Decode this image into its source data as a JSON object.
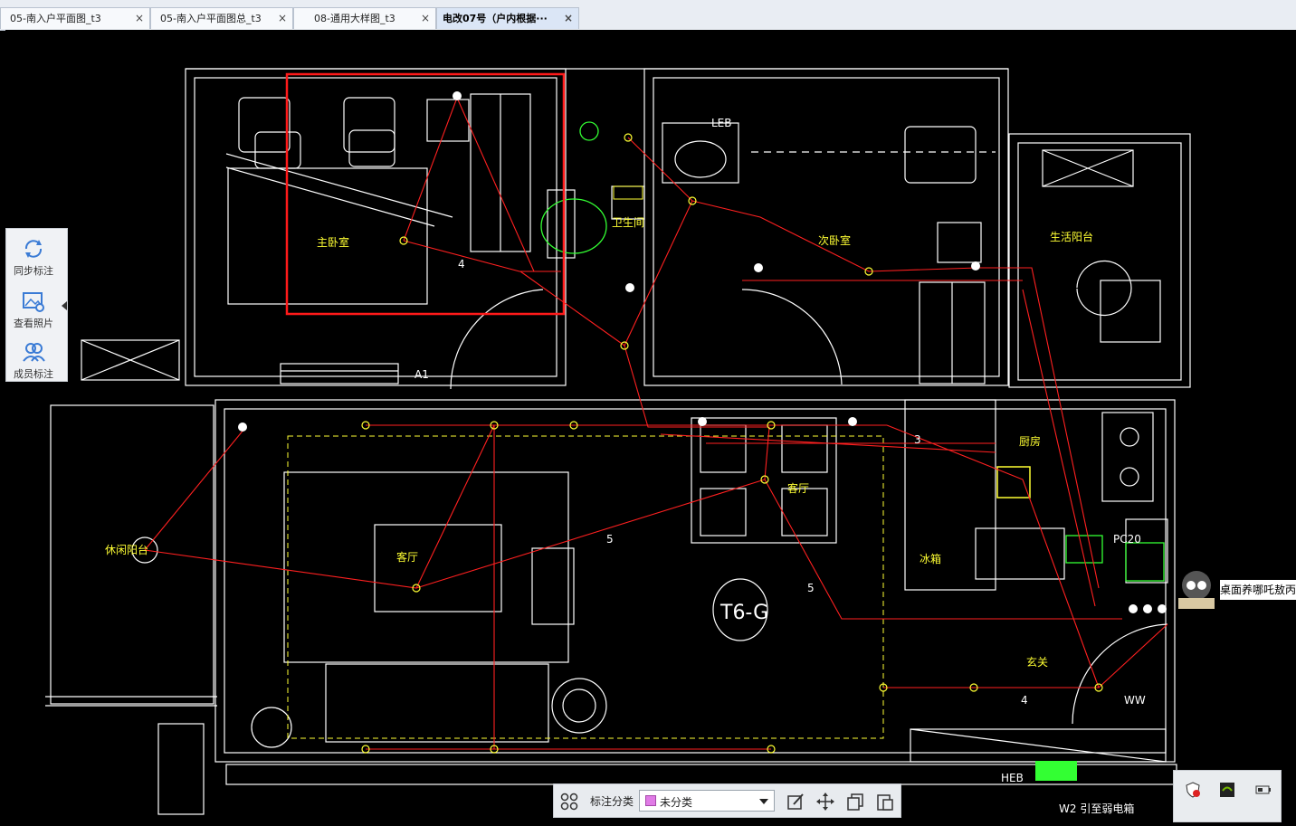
{
  "tabs": [
    {
      "label": "05-南入户平面图_t3",
      "active": false
    },
    {
      "label": "05-南入户平面图总_t3",
      "active": false
    },
    {
      "label": "08-通用大样图_t3",
      "active": false
    },
    {
      "label": "电改07号（户内根据···",
      "active": true
    }
  ],
  "tab_close_glyph": "×",
  "left_toolbar": [
    {
      "label": "同步标注",
      "icon": "sync-icon"
    },
    {
      "label": "查看照片",
      "icon": "photo-search-icon"
    },
    {
      "label": "成员标注",
      "icon": "members-icon"
    }
  ],
  "drawing_labels": {
    "master_bedroom": "主卧室",
    "bathroom": "卫生间",
    "second_bedroom": "次卧室",
    "living_balcony": "生活阳台",
    "leisure_balcony": "休闲阳台",
    "living_room": "客厅",
    "living_room_2": "客厅",
    "kitchen": "厨房",
    "fridge": "冰箱",
    "entrance": "玄关",
    "leb": "LEB",
    "heb": "HEB",
    "pc20": "PC20",
    "a1": "A1",
    "ww": "WW",
    "stamp": "T6-G",
    "w2_note": "W2  引至弱电箱",
    "num_4a": "4",
    "num_5a": "5",
    "num_5b": "5",
    "num_3": "3",
    "num_4b": "4"
  },
  "bottom_toolbar": {
    "category_label": "标注分类",
    "category_value": "未分类",
    "category_color": "#e07be6",
    "icons": [
      "grid-icon",
      "edit-icon",
      "move-icon",
      "copy-icon",
      "paste-icon"
    ]
  },
  "notification": {
    "text": "桌面养哪吒敖丙"
  },
  "colors": {
    "wire": "#ff2020",
    "highlight_box": "#ff1a1a",
    "cad_text": "#ffff33",
    "lines": "#ffffff",
    "fixture": "#33ff33"
  }
}
